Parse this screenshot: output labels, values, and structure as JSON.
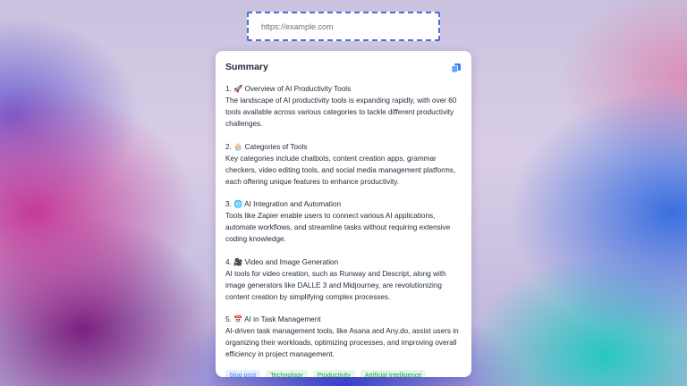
{
  "url_bar": {
    "placeholder": "https://example.com"
  },
  "summary": {
    "title": "Summary",
    "copy_icon": "copy-icon",
    "sections": [
      {
        "heading": "1. 🚀 Overview of AI Productivity Tools",
        "body": "The landscape of AI productivity tools is expanding rapidly, with over 60 tools available across various categories to tackle different productivity challenges."
      },
      {
        "heading": "2. 🧁 Categories of Tools",
        "body": "Key categories include chatbots, content creation apps, grammar checkers, video editing tools, and social media management platforms, each offering unique features to enhance productivity."
      },
      {
        "heading": "3. 🌐 AI Integration and Automation",
        "body": "Tools like Zapier enable users to connect various AI applications, automate workflows, and streamline tasks without requiring extensive coding knowledge."
      },
      {
        "heading": "4. 🎥 Video and Image Generation",
        "body": "AI tools for video creation, such as Runway and Descript, along with image generators like DALLE 3 and Midjourney, are revolutionizing content creation by simplifying complex processes."
      },
      {
        "heading": "5. 📅 AI in Task Management",
        "body": "AI-driven task management tools, like Asana and Any.do, assist users in organizing their workloads, optimizing processes, and improving overall efficiency in project management."
      }
    ],
    "tags": [
      "blog post",
      "Technology",
      "Productivity",
      "Artificial Intelligence"
    ]
  },
  "colors": {
    "tag_blue_text": "#3b82f6",
    "tag_green_text": "#16a34a",
    "url_border": "#4a6fd6"
  }
}
